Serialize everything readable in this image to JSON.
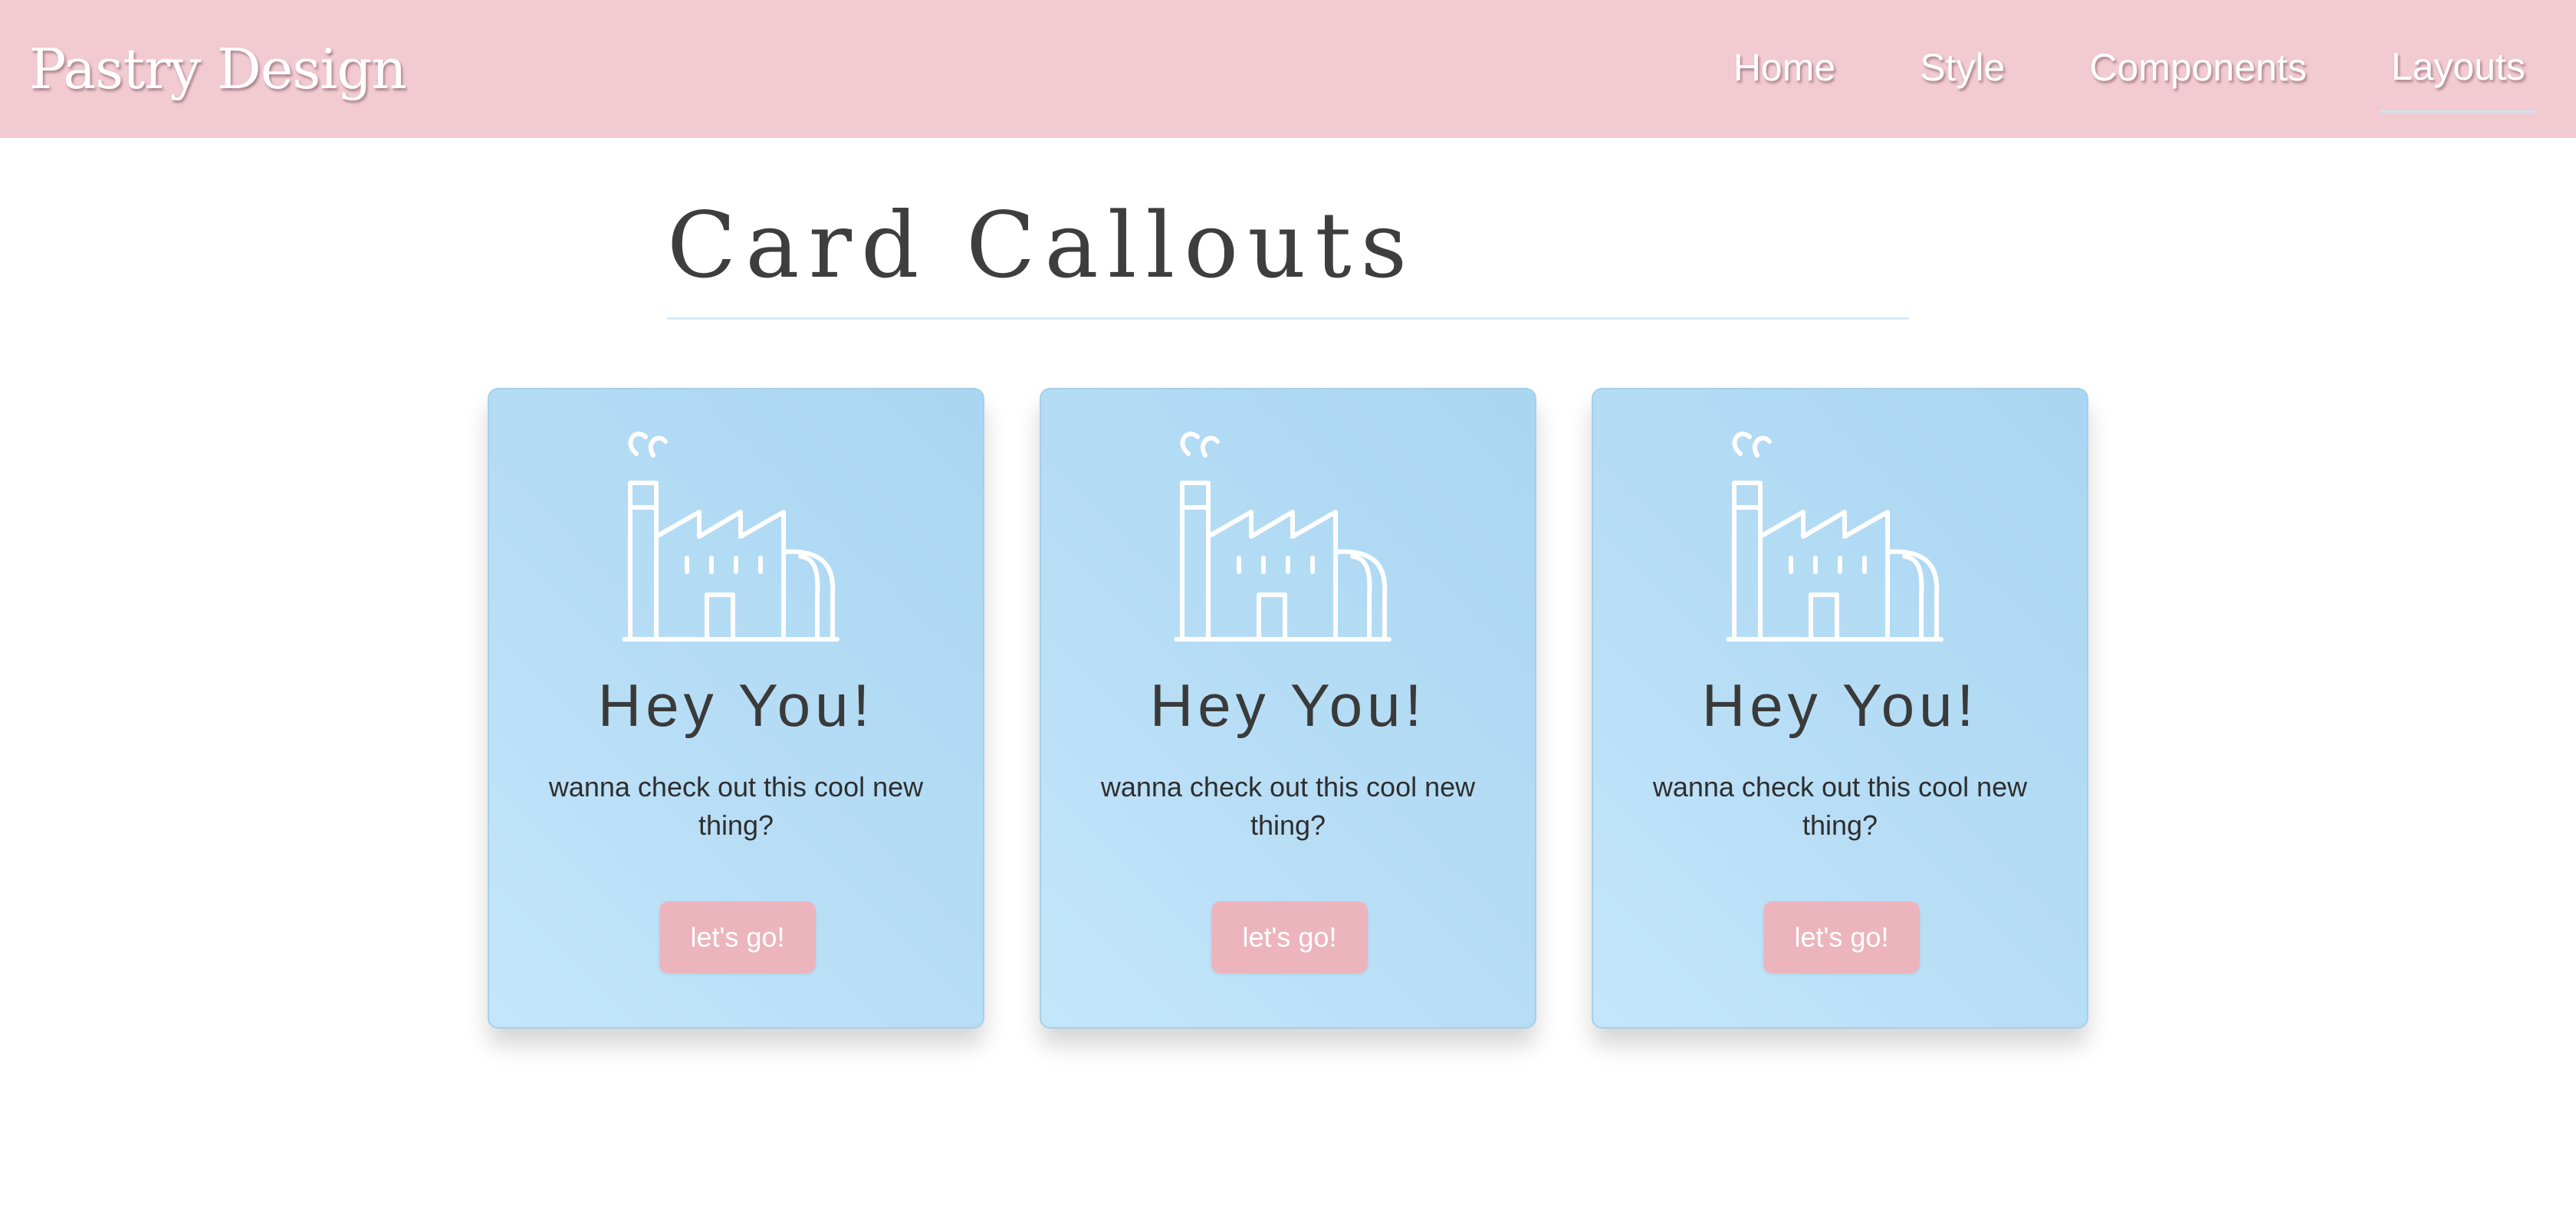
{
  "navbar": {
    "brand": "Pastry Design",
    "links": [
      {
        "label": "Home"
      },
      {
        "label": "Style"
      },
      {
        "label": "Components"
      },
      {
        "label": "Layouts",
        "active": true
      }
    ]
  },
  "main": {
    "title": "Card Callouts"
  },
  "cards": [
    {
      "icon": "factory-icon",
      "title": "Hey You!",
      "text": "wanna check out this cool new thing?",
      "button_label": "let's go!"
    },
    {
      "icon": "factory-icon",
      "title": "Hey You!",
      "text": "wanna check out this cool new thing?",
      "button_label": "let's go!"
    },
    {
      "icon": "factory-icon",
      "title": "Hey You!",
      "text": "wanna check out this cool new thing?",
      "button_label": "let's go!"
    }
  ],
  "colors": {
    "navbar_bg": "#f2cad1",
    "card_bg": "#b8def6",
    "button_bg": "#ecb5bd",
    "divider": "#d6ebf8"
  }
}
